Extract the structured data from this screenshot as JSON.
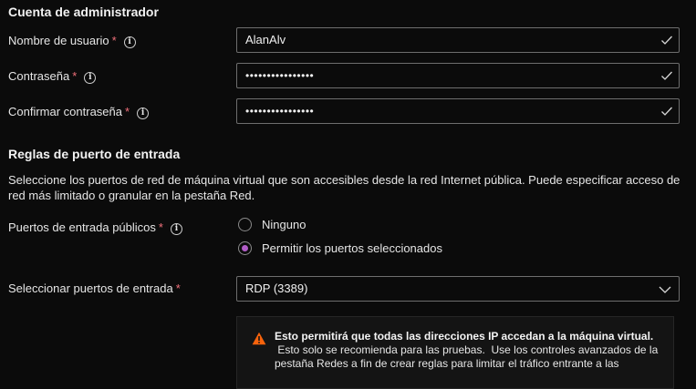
{
  "admin": {
    "title": "Cuenta de administrador",
    "username_label": "Nombre de usuario",
    "username_value": "AlanAlv",
    "password_label": "Contraseña",
    "password_value": "••••••••••••••••",
    "confirm_label": "Confirmar contraseña",
    "confirm_value": "••••••••••••••••",
    "required_mark": "*",
    "info_glyph": "i"
  },
  "ports": {
    "title": "Reglas de puerto de entrada",
    "description": "Seleccione los puertos de red de máquina virtual que son accesibles desde la red Internet pública. Puede especificar acceso de red más limitado o granular en la pestaña Red.",
    "public_label": "Puertos de entrada públicos",
    "options": [
      {
        "label": "Ninguno",
        "selected": false
      },
      {
        "label": "Permitir los puertos seleccionados",
        "selected": true
      }
    ],
    "select_label": "Seleccionar puertos de entrada",
    "select_value": "RDP (3389)"
  },
  "warning": {
    "title": "Esto permitirá que todas las direcciones IP accedan a la máquina virtual.",
    "body": " Esto solo se recomienda para las pruebas.  Use los controles avanzados de la pestaña Redes a fin de crear reglas para limitar el tráfico entrante a las"
  },
  "icons": {
    "valid": "check-icon",
    "info": "info-icon",
    "dropdown": "chevron-down-icon",
    "warning": "warning-triangle-icon"
  },
  "colors": {
    "background": "#0b0b0b",
    "required": "#f1707b",
    "radio_selected": "#b15dc7",
    "warning_icon": "#f7630c",
    "field_border": "#6e6e6e"
  }
}
